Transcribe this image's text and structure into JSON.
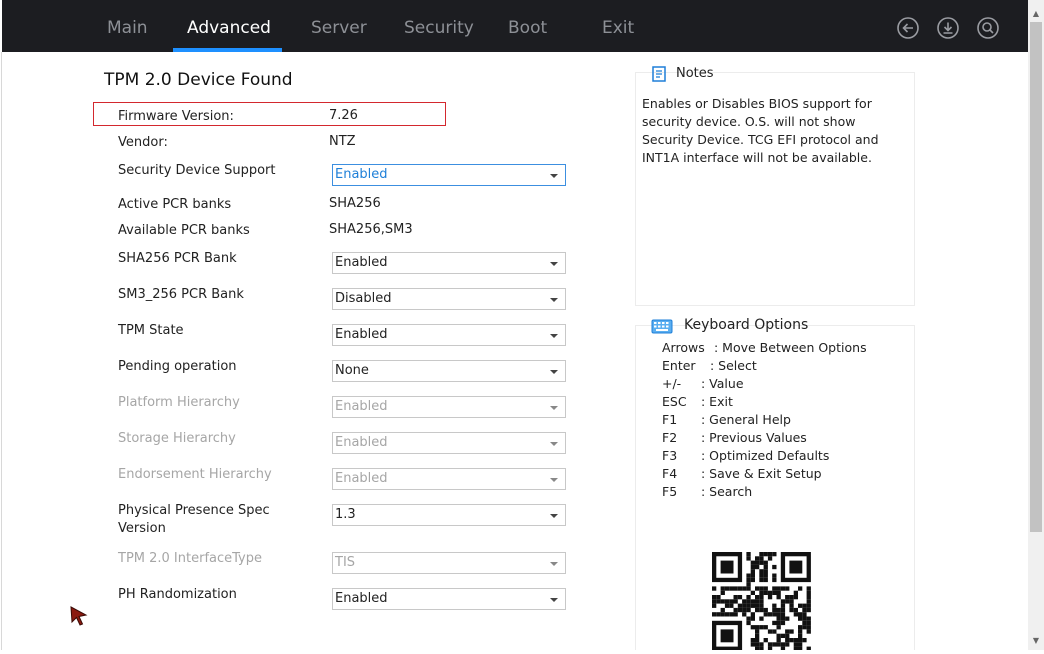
{
  "tabs": [
    {
      "label": "Main"
    },
    {
      "label": "Advanced"
    },
    {
      "label": "Server"
    },
    {
      "label": "Security"
    },
    {
      "label": "Boot"
    },
    {
      "label": "Exit"
    }
  ],
  "top_icons": [
    "back-icon",
    "save-icon",
    "search-icon"
  ],
  "page_title": "TPM 2.0 Device Found",
  "info": {
    "firmware_label": "Firmware Version:",
    "firmware_value": "7.26",
    "vendor_label": "Vendor:",
    "vendor_value": "NTZ",
    "active_pcr_label": "Active PCR banks",
    "active_pcr_value": "SHA256",
    "available_pcr_label": "Available PCR banks",
    "available_pcr_value": "SHA256,SM3"
  },
  "settings": {
    "security_device_support": {
      "label": "Security Device Support",
      "value": "Enabled"
    },
    "sha256_pcr_bank": {
      "label": "SHA256 PCR Bank",
      "value": "Enabled"
    },
    "sm3_pcr_bank": {
      "label": "SM3_256 PCR Bank",
      "value": "Disabled"
    },
    "tpm_state": {
      "label": "TPM State",
      "value": "Enabled"
    },
    "pending_operation": {
      "label": "Pending operation",
      "value": "None"
    },
    "platform_hierarchy": {
      "label": "Platform Hierarchy",
      "value": "Enabled"
    },
    "storage_hierarchy": {
      "label": "Storage Hierarchy",
      "value": "Enabled"
    },
    "endorsement_hierarchy": {
      "label": "Endorsement Hierarchy",
      "value": "Enabled"
    },
    "pps_version": {
      "label_line1": "Physical Presence Spec",
      "label_line2": "Version",
      "value": "1.3"
    },
    "interface_type": {
      "label": "TPM 2.0 InterfaceType",
      "value": "TIS"
    },
    "ph_randomization": {
      "label": "PH Randomization",
      "value": "Enabled"
    }
  },
  "help": {
    "title": "Notes",
    "lines": [
      "Enables or Disables BIOS support for",
      "security device. O.S. will not show",
      "Security Device. TCG EFI protocol and",
      "INT1A interface will not be available."
    ]
  },
  "keyboard": {
    "title": "Keyboard Options",
    "rows": [
      {
        "key": "Arrows",
        "desc": ": Move Between Options"
      },
      {
        "key": "Enter",
        "desc": ": Select"
      },
      {
        "key": "+/-",
        "desc": ": Value"
      },
      {
        "key": "ESC",
        "desc": ": Exit"
      },
      {
        "key": "F1",
        "desc": ": General Help"
      },
      {
        "key": "F2",
        "desc": ": Previous Values"
      },
      {
        "key": "F3",
        "desc": ": Optimized Defaults"
      },
      {
        "key": "F4",
        "desc": ": Save & Exit Setup"
      },
      {
        "key": "F5",
        "desc": ": Search"
      }
    ]
  },
  "colors": {
    "topbar": "#1c1d21",
    "accent": "#1e90ff",
    "highlight_box": "#d3282e",
    "disabled_text": "#a6a6a6"
  }
}
